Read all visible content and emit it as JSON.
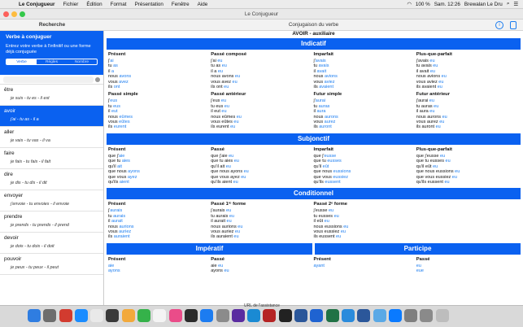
{
  "menubar": {
    "items": [
      "Le Conjugueur",
      "Fichier",
      "Édition",
      "Format",
      "Présentation",
      "Fenêtre",
      "Aide"
    ],
    "battery": "100 %",
    "clock": "Sam. 12:26",
    "user": "Brewalan Le Dru"
  },
  "window": {
    "title": "Le Conjugueur"
  },
  "toolbar": {
    "left_title": "Recherche",
    "center_title": "Conjugaison du verbe"
  },
  "sidebar": {
    "panel_title": "Verbe à conjuguer",
    "panel_subtitle": "Entrez votre verbe à l'infinitif ou une forme déjà conjuguée",
    "segments": [
      "Verbe",
      "Règles",
      "Nombre"
    ],
    "verbs": [
      {
        "name": "être",
        "forms": "je suis - tu es - il est"
      },
      {
        "name": "avoir",
        "forms": "j'ai - tu as - il a"
      },
      {
        "name": "aller",
        "forms": "je vais - tu vas - il va"
      },
      {
        "name": "faire",
        "forms": "je fais - tu fais - il fait"
      },
      {
        "name": "dire",
        "forms": "je dis - tu dis - il dit"
      },
      {
        "name": "envoyer",
        "forms": "j'envoie - tu envoies - il envoie"
      },
      {
        "name": "prendre",
        "forms": "je prends - tu prends - il prend"
      },
      {
        "name": "devoir",
        "forms": "je dois - tu dois - il doit"
      },
      {
        "name": "pouvoir",
        "forms": "je peux - tu peux - il peut"
      }
    ]
  },
  "main": {
    "verb_title": "AVOIR - auxiliaire",
    "sections": [
      {
        "title": "Indicatif",
        "tenses": [
          {
            "name": "Présent",
            "lines": [
              [
                "j'",
                "ai"
              ],
              [
                "tu ",
                "as"
              ],
              [
                "il ",
                "a"
              ],
              [
                "nous ",
                "avons"
              ],
              [
                "vous ",
                "avez"
              ],
              [
                "ils ",
                "ont"
              ]
            ]
          },
          {
            "name": "Passé composé",
            "lines": [
              [
                "j'ai ",
                "eu"
              ],
              [
                "tu as ",
                "eu"
              ],
              [
                "il a ",
                "eu"
              ],
              [
                "nous avons ",
                "eu"
              ],
              [
                "vous avez ",
                "eu"
              ],
              [
                "ils ont ",
                "eu"
              ]
            ]
          },
          {
            "name": "Imparfait",
            "lines": [
              [
                "j'",
                "avais"
              ],
              [
                "tu ",
                "avais"
              ],
              [
                "il ",
                "avait"
              ],
              [
                "nous ",
                "avions"
              ],
              [
                "vous ",
                "aviez"
              ],
              [
                "ils ",
                "avaient"
              ]
            ]
          },
          {
            "name": "Plus-que-parfait",
            "lines": [
              [
                "j'avais ",
                "eu"
              ],
              [
                "tu avais ",
                "eu"
              ],
              [
                "il avait ",
                "eu"
              ],
              [
                "nous avions ",
                "eu"
              ],
              [
                "vous aviez ",
                "eu"
              ],
              [
                "ils avaient ",
                "eu"
              ]
            ]
          },
          {
            "name": "Passé simple",
            "lines": [
              [
                "j'",
                "eus"
              ],
              [
                "tu ",
                "eus"
              ],
              [
                "il ",
                "eut"
              ],
              [
                "nous ",
                "eûmes"
              ],
              [
                "vous ",
                "eûtes"
              ],
              [
                "ils ",
                "eurent"
              ]
            ]
          },
          {
            "name": "Passé antérieur",
            "lines": [
              [
                "j'eus ",
                "eu"
              ],
              [
                "tu eus ",
                "eu"
              ],
              [
                "il eut ",
                "eu"
              ],
              [
                "nous eûmes ",
                "eu"
              ],
              [
                "vous eûtes ",
                "eu"
              ],
              [
                "ils eurent ",
                "eu"
              ]
            ]
          },
          {
            "name": "Futur simple",
            "lines": [
              [
                "j'",
                "aurai"
              ],
              [
                "tu ",
                "auras"
              ],
              [
                "il ",
                "aura"
              ],
              [
                "nous ",
                "aurons"
              ],
              [
                "vous ",
                "aurez"
              ],
              [
                "ils ",
                "auront"
              ]
            ]
          },
          {
            "name": "Futur antérieur",
            "lines": [
              [
                "j'aurai ",
                "eu"
              ],
              [
                "tu auras ",
                "eu"
              ],
              [
                "il aura ",
                "eu"
              ],
              [
                "nous aurons ",
                "eu"
              ],
              [
                "vous aurez ",
                "eu"
              ],
              [
                "ils auront ",
                "eu"
              ]
            ]
          }
        ]
      },
      {
        "title": "Subjonctif",
        "tenses": [
          {
            "name": "Présent",
            "lines": [
              [
                "que j'",
                "aie"
              ],
              [
                "que tu ",
                "aies"
              ],
              [
                "qu'il ",
                "ait"
              ],
              [
                "que nous ",
                "ayons"
              ],
              [
                "que vous ",
                "ayez"
              ],
              [
                "qu'ils ",
                "aient"
              ]
            ]
          },
          {
            "name": "Passé",
            "lines": [
              [
                "que j'aie ",
                "eu"
              ],
              [
                "que tu aies ",
                "eu"
              ],
              [
                "qu'il ait ",
                "eu"
              ],
              [
                "que nous ayons ",
                "eu"
              ],
              [
                "que vous ayez ",
                "eu"
              ],
              [
                "qu'ils aient ",
                "eu"
              ]
            ]
          },
          {
            "name": "Imparfait",
            "lines": [
              [
                "que j'",
                "eusse"
              ],
              [
                "que tu ",
                "eusses"
              ],
              [
                "qu'il ",
                "eût"
              ],
              [
                "que nous ",
                "eussions"
              ],
              [
                "que vous ",
                "eussiez"
              ],
              [
                "qu'ils ",
                "eussent"
              ]
            ]
          },
          {
            "name": "Plus-que-parfait",
            "lines": [
              [
                "que j'eusse ",
                "eu"
              ],
              [
                "que tu eusses ",
                "eu"
              ],
              [
                "qu'il eût ",
                "eu"
              ],
              [
                "que nous eussions ",
                "eu"
              ],
              [
                "que vous eussiez ",
                "eu"
              ],
              [
                "qu'ils eussent ",
                "eu"
              ]
            ]
          }
        ]
      },
      {
        "title": "Conditionnel",
        "tenses": [
          {
            "name": "Présent",
            "lines": [
              [
                "j'",
                "aurais"
              ],
              [
                "tu ",
                "aurais"
              ],
              [
                "il ",
                "aurait"
              ],
              [
                "nous ",
                "aurions"
              ],
              [
                "vous ",
                "auriez"
              ],
              [
                "ils ",
                "auraient"
              ]
            ]
          },
          {
            "name": "Passé 1ʳᵉ forme",
            "lines": [
              [
                "j'aurais ",
                "eu"
              ],
              [
                "tu aurais ",
                "eu"
              ],
              [
                "il aurait ",
                "eu"
              ],
              [
                "nous aurions ",
                "eu"
              ],
              [
                "vous auriez ",
                "eu"
              ],
              [
                "ils auraient ",
                "eu"
              ]
            ]
          },
          {
            "name": "Passé 2ᵉ forme",
            "lines": [
              [
                "j'eusse ",
                "eu"
              ],
              [
                "tu eusses ",
                "eu"
              ],
              [
                "il eût ",
                "eu"
              ],
              [
                "nous eussions ",
                "eu"
              ],
              [
                "vous eussiez ",
                "eu"
              ],
              [
                "ils eussent ",
                "eu"
              ]
            ]
          }
        ]
      }
    ],
    "bottom": {
      "left_title": "Impératif",
      "right_title": "Participe",
      "imperatif": [
        {
          "name": "Présent",
          "lines": [
            [
              "",
              "aie"
            ],
            [
              "",
              "ayons"
            ]
          ]
        },
        {
          "name": "Passé",
          "lines": [
            [
              "aie ",
              "eu"
            ],
            [
              "ayons ",
              "eu"
            ]
          ]
        }
      ],
      "participe": [
        {
          "name": "Présent",
          "lines": [
            [
              "",
              "ayant"
            ]
          ]
        },
        {
          "name": "Passé",
          "lines": [
            [
              "",
              "eu"
            ],
            [
              "",
              "eue"
            ]
          ]
        }
      ]
    }
  },
  "dock": {
    "tooltip": "URL de l'assistance",
    "colors": [
      "#2f7de1",
      "#6d6d6d",
      "#d23b2f",
      "#1a8cff",
      "#e9e9e9",
      "#3a3a3a",
      "#f2a93b",
      "#35b24a",
      "#f4f4f4",
      "#ea4c89",
      "#2b2b2b",
      "#1c7cf1",
      "#8b8b8b",
      "#5a2ca0",
      "#1a8ad3",
      "#b52323",
      "#222222",
      "#2b579a",
      "#1f63d1",
      "#207245",
      "#2a8bdc",
      "#2b579a",
      "#5aa9e6",
      "#0a7aff",
      "#7f7f7f",
      "#8a8a8a",
      "#bdbdbd"
    ]
  }
}
